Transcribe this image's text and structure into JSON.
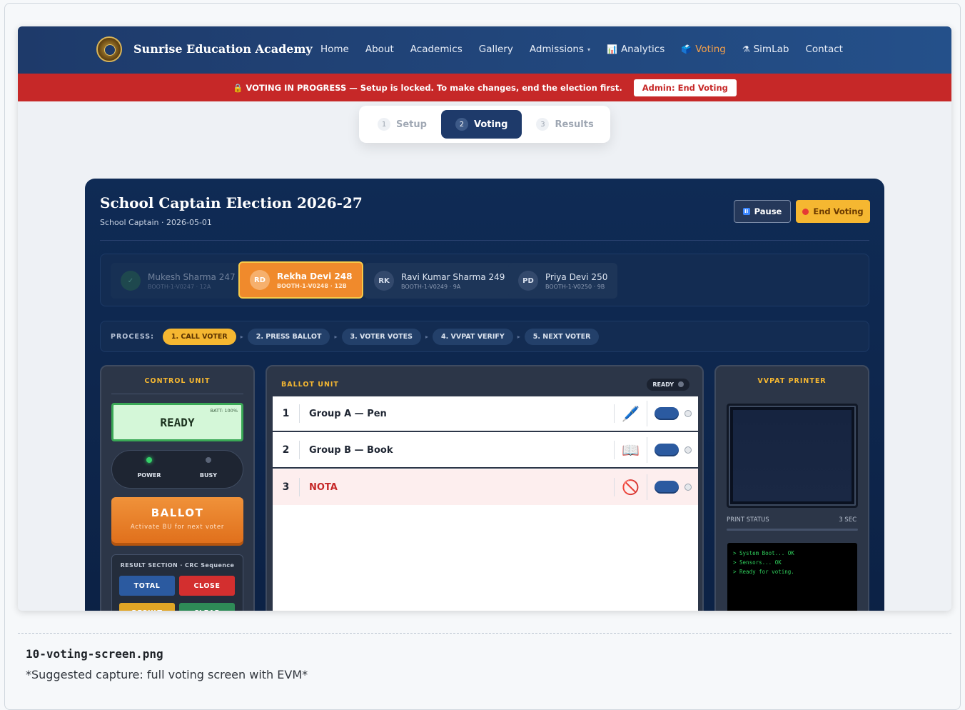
{
  "nav": {
    "brand": "Sunrise Education Academy",
    "items": [
      {
        "label": "Home",
        "icon": ""
      },
      {
        "label": "About",
        "icon": ""
      },
      {
        "label": "Academics",
        "icon": ""
      },
      {
        "label": "Gallery",
        "icon": ""
      },
      {
        "label": "Admissions",
        "icon": "",
        "caret": "▾"
      },
      {
        "label": "Analytics",
        "icon": "📊"
      },
      {
        "label": "Voting",
        "icon": "🗳️"
      },
      {
        "label": "SimLab",
        "icon": "⚗"
      },
      {
        "label": "Contact",
        "icon": ""
      }
    ],
    "active_color": "#f5a04a"
  },
  "banner": {
    "text": "🔒 VOTING IN PROGRESS — Setup is locked. To make changes, end the election first.",
    "button": "Admin: End Voting"
  },
  "stepper": [
    {
      "num": "1",
      "label": "Setup"
    },
    {
      "num": "2",
      "label": "Voting"
    },
    {
      "num": "3",
      "label": "Results"
    }
  ],
  "election": {
    "title": "School Captain Election 2026-27",
    "subtitle": "School Captain · 2026-05-01",
    "pause_label": "Pause",
    "pause_icon": "II",
    "end_label": "End Voting"
  },
  "queue": [
    {
      "initials": "✓",
      "name": "Mukesh Sharma 247",
      "id": "BOOTH-1-V0247 · 12A",
      "state": "done"
    },
    {
      "initials": "RD",
      "name": "Rekha Devi 248",
      "id": "BOOTH-1-V0248 · 12B",
      "state": "current"
    },
    {
      "initials": "RK",
      "name": "Ravi Kumar Sharma 249",
      "id": "BOOTH-1-V0249 · 9A",
      "state": "waiting"
    },
    {
      "initials": "PD",
      "name": "Priya Devi 250",
      "id": "BOOTH-1-V0250 · 9B",
      "state": "waiting"
    }
  ],
  "process": {
    "label": "PROCESS:",
    "steps": [
      "1. CALL VOTER",
      "2. PRESS BALLOT",
      "3. VOTER VOTES",
      "4. VVPAT VERIFY",
      "5. NEXT VOTER"
    ],
    "arrow": "▸"
  },
  "control_unit": {
    "title": "CONTROL UNIT",
    "display": "READY",
    "battery": "BATT: 100%",
    "power_label": "POWER",
    "busy_label": "BUSY",
    "ballot_label": "BALLOT",
    "ballot_sub": "Activate BU for next voter",
    "result_title": "RESULT SECTION · CRC Sequence",
    "total_label": "TOTAL",
    "close_label": "CLOSE",
    "result_label": "RESULT",
    "clear_label": "CLEAR"
  },
  "ballot_unit": {
    "title": "BALLOT UNIT",
    "status": "READY",
    "rows": [
      {
        "num": "1",
        "name": "Group A — Pen",
        "symbol": "🖊️"
      },
      {
        "num": "2",
        "name": "Group B — Book",
        "symbol": "📖"
      },
      {
        "num": "3",
        "name": "NOTA",
        "symbol": "🚫"
      }
    ]
  },
  "vvpat": {
    "title": "VVPAT PRINTER",
    "status_label": "PRINT STATUS",
    "seconds": "3 SEC",
    "log": [
      "> System Boot... OK",
      "> Sensors... OK",
      "> Ready for voting."
    ]
  },
  "caption": {
    "filename": "10-voting-screen.png",
    "note": "*Suggested capture: full voting screen with EVM*"
  }
}
